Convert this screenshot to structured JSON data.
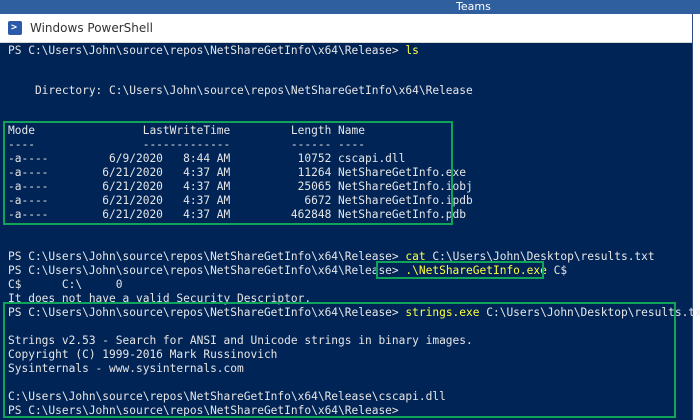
{
  "background_app": {
    "title": "Teams"
  },
  "window": {
    "title": "Windows PowerShell"
  },
  "terminal": {
    "prompt": "PS C:\\Users\\John\\source\\repos\\NetShareGetInfo\\x64\\Release>",
    "cmd_ls": "ls",
    "directory_line": "    Directory: C:\\Users\\John\\source\\repos\\NetShareGetInfo\\x64\\Release",
    "table_header": "Mode                LastWriteTime         Length Name",
    "table_underline": "----                -------------         ------ ----",
    "rows": [
      "-a----         6/9/2020   8:44 AM          10752 cscapi.dll",
      "-a----        6/21/2020   4:37 AM          11264 NetShareGetInfo.exe",
      "-a----        6/21/2020   4:37 AM          25065 NetShareGetInfo.iobj",
      "-a----        6/21/2020   4:37 AM           6672 NetShareGetInfo.ipdb",
      "-a----        6/21/2020   4:37 AM         462848 NetShareGetInfo.pdb"
    ],
    "cmd_cat": "cat",
    "cmd_cat_arg": " C:\\Users\\John\\Desktop\\results.txt",
    "cmd_run": ".\\NetShareGetInfo.exe",
    "cmd_run_arg": " C$",
    "output_share": "C$      C:\\     0",
    "output_desc": "It does not have a valid Security Descriptor.",
    "cmd_strings": "strings.exe",
    "cmd_strings_arg": " C:\\Users\\John\\Desktop\\results.txt",
    "strings_banner": "Strings v2.53 - Search for ANSI and Unicode strings in binary images.",
    "strings_copyright": "Copyright (C) 1999-2016 Mark Russinovich",
    "strings_site": "Sysinternals - www.sysinternals.com",
    "strings_result": "C:\\Users\\John\\source\\repos\\NetShareGetInfo\\x64\\Release\\cscapi.dll"
  },
  "colors": {
    "console_bg": "#012456",
    "console_text": "#e6e6e6",
    "command_text": "#ffff3c",
    "highlight_box": "#10a35a"
  }
}
